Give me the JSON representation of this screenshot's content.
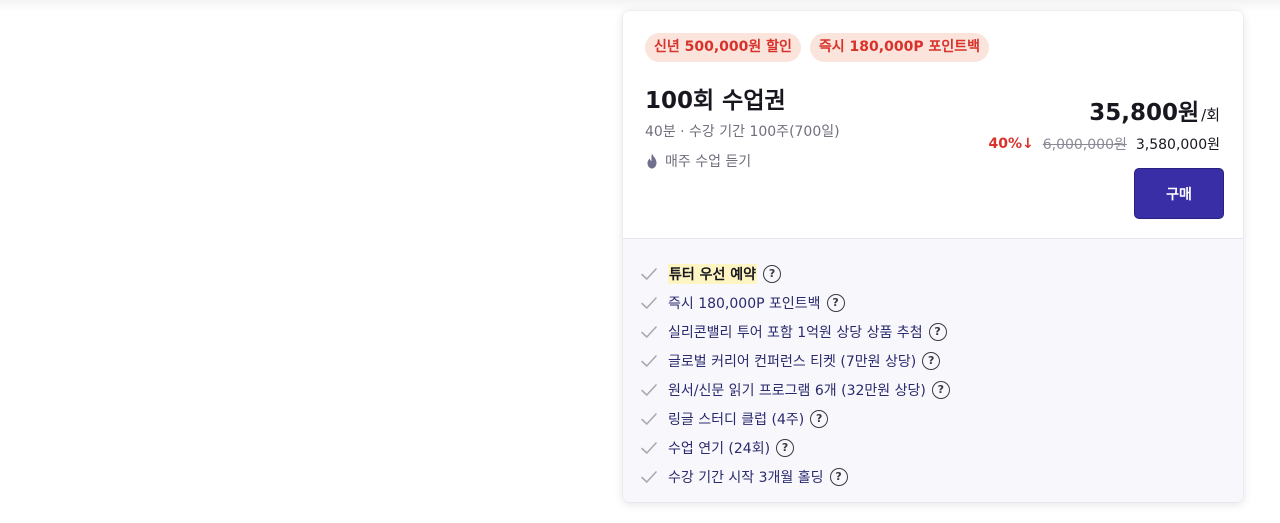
{
  "badges": [
    "신년 500,000원 할인",
    "즉시 180,000P 포인트백"
  ],
  "plan": {
    "title": "100회 수업권",
    "meta": "40분 · 수강 기간 100주(700일)",
    "weekly": "매주 수업 듣기"
  },
  "price": {
    "per_lesson": "35,800원",
    "per_unit": "/회",
    "discount": "40%↓",
    "original": "6,000,000원",
    "final": "3,580,000원"
  },
  "buy_label": "구매",
  "features": [
    "튜터 우선 예약",
    "즉시 180,000P 포인트백",
    "실리콘밸리 투어 포함 1억원 상당 상품 추첨",
    "글로벌 커리어 컨퍼런스 티켓 (7만원 상당)",
    "원서/신문 읽기 프로그램 6개 (32만원 상당)",
    "링글 스터디 클럽 (4주)",
    "수업 연기 (24회)",
    "수강 기간 시작 3개월 홀딩"
  ],
  "help_glyph": "?",
  "icons": {
    "flame": "flame-icon",
    "check": "check-icon",
    "help": "question-circle-icon"
  },
  "colors": {
    "accent": "#3a2ea7",
    "badge_bg": "#fbe4dc",
    "badge_text": "#d8322b",
    "highlight": "#fff5c2"
  }
}
